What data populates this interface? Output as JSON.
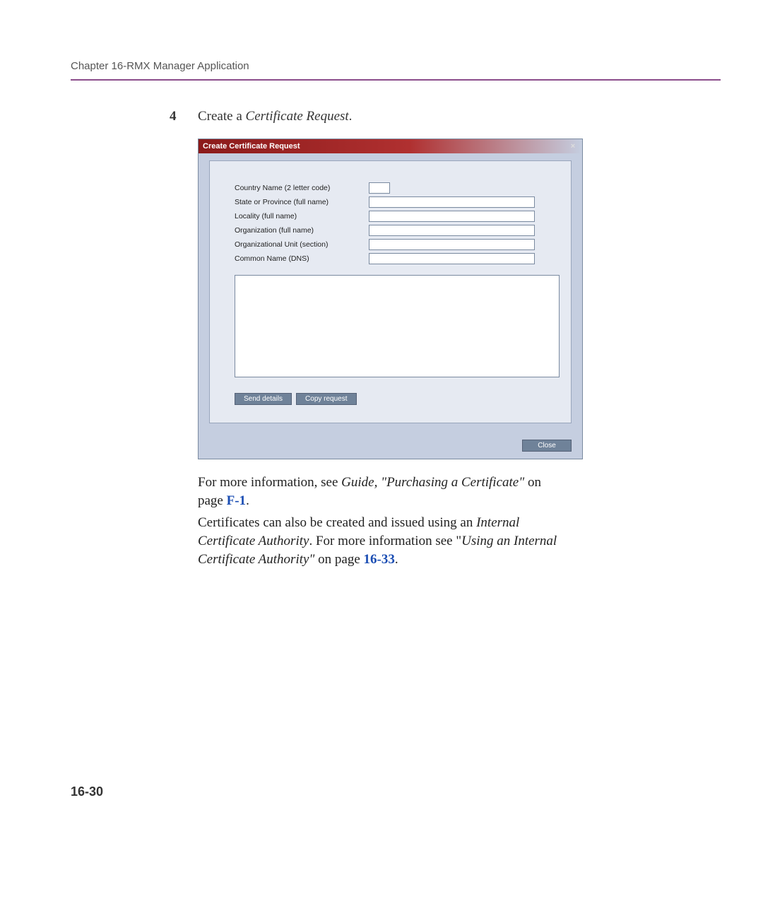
{
  "header": {
    "chapter": "Chapter 16-RMX Manager Application"
  },
  "step": {
    "number": "4",
    "prefix": "Create a ",
    "italic": "Certificate Request",
    "suffix": "."
  },
  "dialog": {
    "title": "Create Certificate Request",
    "fields": {
      "country": "Country Name (2 letter code)",
      "state": "State or Province (full name)",
      "locality": "Locality (full name)",
      "organization": "Organization (full name)",
      "org_unit": "Organizational Unit (section)",
      "common_name": "Common Name (DNS)"
    },
    "buttons": {
      "send_details": "Send details",
      "copy_request": "Copy request",
      "close": "Close"
    }
  },
  "paragraphs": {
    "p1_a": "For more information, see ",
    "p1_i": "Guide, \"Purchasing a Certificate\"",
    "p1_b": " on page ",
    "p1_link": "F-1",
    "p1_c": ".",
    "p2_a": "Certificates can also be created and issued using an ",
    "p2_i1": "Internal Certificate Authority",
    "p2_b": ". For more information see \"",
    "p2_i2": "Using an Internal Certificate Authority\"",
    "p2_c": " on page ",
    "p2_link": "16-33",
    "p2_d": "."
  },
  "page_number": "16-30"
}
